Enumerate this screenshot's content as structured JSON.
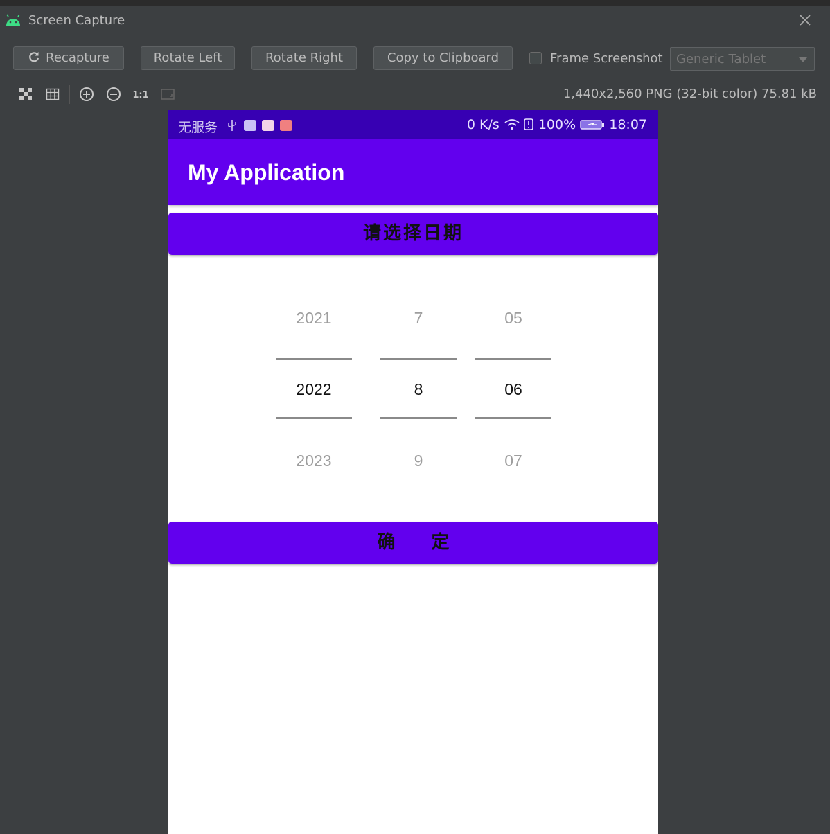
{
  "window": {
    "title": "Screen Capture",
    "icon": "android-icon"
  },
  "toolbar": {
    "recapture": "Recapture",
    "rotate_left": "Rotate Left",
    "rotate_right": "Rotate Right",
    "copy": "Copy to Clipboard",
    "frame_screenshot": "Frame Screenshot",
    "frame_checked": false,
    "device_select": "Generic Tablet"
  },
  "image_info": "1,440x2,560 PNG (32-bit color) 75.81 kB",
  "phone": {
    "status": {
      "carrier": "无服务",
      "speed": "0 K/s",
      "battery": "100%",
      "time": "18:07"
    },
    "app_title": "My Application",
    "select_date_button": "请选择日期",
    "confirm_button": "确　　定",
    "pickers": {
      "year": {
        "prev": "2021",
        "selected": "2022",
        "next": "2023"
      },
      "month": {
        "prev": "7",
        "selected": "8",
        "next": "9"
      },
      "day": {
        "prev": "05",
        "selected": "06",
        "next": "07"
      }
    }
  },
  "colors": {
    "primary": "#6200ee",
    "primary_dark": "#3700b3",
    "ide_bg": "#3c3f41"
  }
}
